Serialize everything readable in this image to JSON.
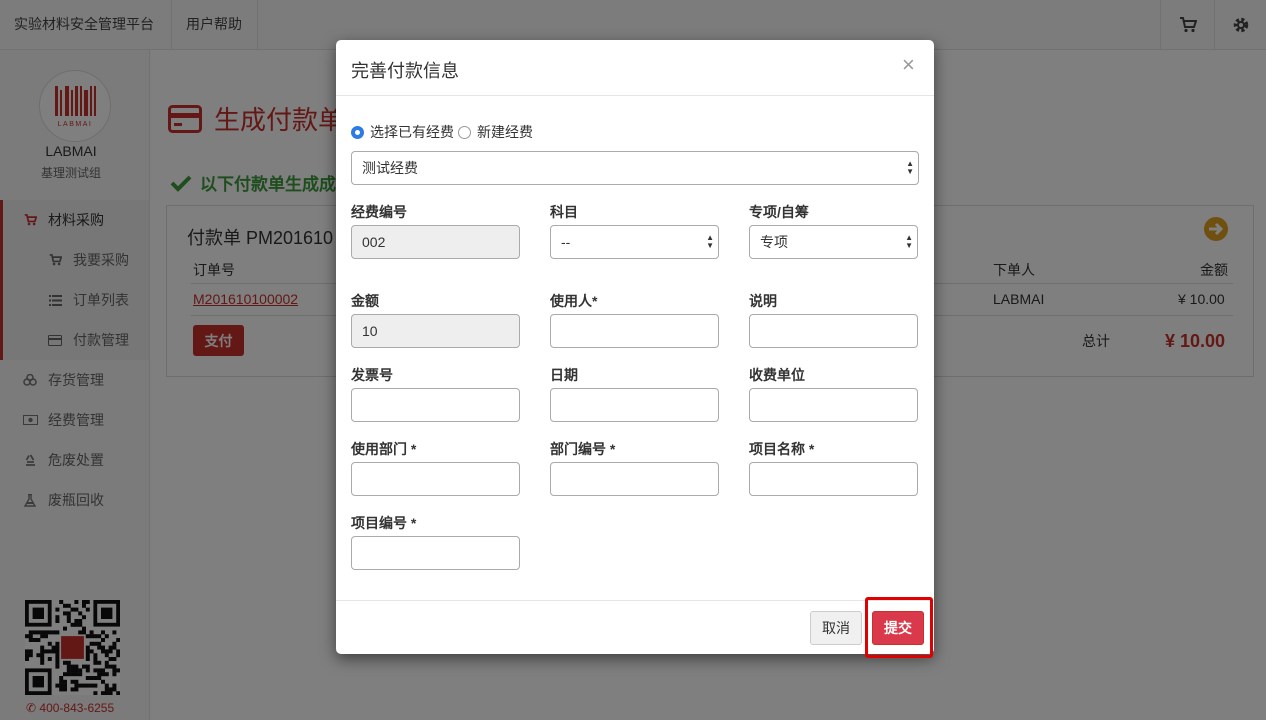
{
  "topbar": {
    "brand": "实验材料安全管理平台",
    "help": "用户帮助",
    "cart_icon": "cart-icon",
    "gear_icon": "gear-icon"
  },
  "sidebar": {
    "name": "LABMAI",
    "group": "基理测试组",
    "logo_text": "LABMAI",
    "phone": "400-843-6255",
    "items": [
      {
        "label": "材料采购",
        "icon": "cart-icon"
      },
      {
        "label": "我要采购",
        "icon": "cart-icon"
      },
      {
        "label": "订单列表",
        "icon": "list-icon"
      },
      {
        "label": "付款管理",
        "icon": "card-icon"
      },
      {
        "label": "存货管理",
        "icon": "boxes-icon"
      },
      {
        "label": "经费管理",
        "icon": "money-icon"
      },
      {
        "label": "危废处置",
        "icon": "recycle-icon"
      },
      {
        "label": "废瓶回收",
        "icon": "flask-icon"
      }
    ]
  },
  "main": {
    "title": "生成付款单",
    "success": "以下付款单生成成",
    "panel_title": "付款单 PM201610",
    "columns": {
      "order_no": "订单号",
      "orderer": "下单人",
      "amount": "金额"
    },
    "row": {
      "order_no": "M201610100002",
      "orderer": "LABMAI",
      "amount": "¥ 10.00"
    },
    "pay_button": "支付",
    "total_label": "总计",
    "total_value": "¥ 10.00"
  },
  "modal": {
    "title": "完善付款信息",
    "close": "×",
    "radio_existing": "选择已有经费",
    "radio_new": "新建经费",
    "fund_select": "测试经费",
    "fields": {
      "fund_no_label": "经费编号",
      "fund_no_value": "002",
      "subject_label": "科目",
      "subject_value": "--",
      "special_label": "专项/自筹",
      "special_value": "专项",
      "amount_label": "金额",
      "amount_value": "10",
      "user_label": "使用人*",
      "note_label": "说明",
      "invoice_label": "发票号",
      "date_label": "日期",
      "payee_label": "收费单位",
      "dept_label": "使用部门 *",
      "dept_no_label": "部门编号 *",
      "project_name_label": "项目名称 *",
      "project_no_label": "项目编号 *"
    },
    "cancel": "取消",
    "submit": "提交"
  },
  "colors": {
    "accent": "#c9302c",
    "success": "#3c9a3c",
    "submit": "#d9394a",
    "highlight": "#e00000"
  }
}
